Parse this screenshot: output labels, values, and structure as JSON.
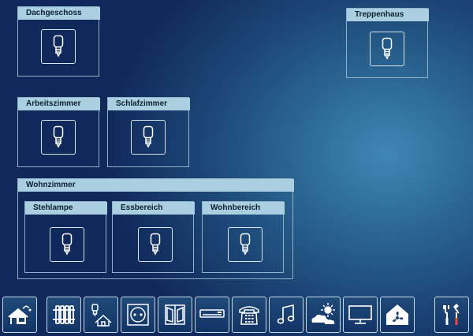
{
  "rooms": {
    "dachgeschoss": "Dachgeschoss",
    "treppenhaus": "Treppenhaus",
    "arbeitszimmer": "Arbeitszimmer",
    "schlafzimmer": "Schlafzimmer",
    "wohnzimmer": "Wohnzimmer",
    "stehlampe": "Stehlampe",
    "essbereich": "Essbereich",
    "wohnbereich": "Wohnbereich"
  },
  "toolbar": {
    "items": [
      {
        "icon": "house-overview-icon"
      },
      {
        "icon": "radiator-icon"
      },
      {
        "icon": "lamp-house-icon"
      },
      {
        "icon": "power-socket-icon"
      },
      {
        "icon": "window-blinds-icon"
      },
      {
        "icon": "air-conditioner-icon"
      },
      {
        "icon": "telephone-icon"
      },
      {
        "icon": "music-note-icon"
      },
      {
        "icon": "weather-icon"
      },
      {
        "icon": "monitor-icon"
      },
      {
        "icon": "house-fan-icon"
      },
      {
        "icon": "tools-icon"
      }
    ]
  },
  "colors": {
    "panel_title_bg": "#aacfe0",
    "panel_border": "#8fb2c8",
    "icon_stroke": "#ffffff"
  }
}
